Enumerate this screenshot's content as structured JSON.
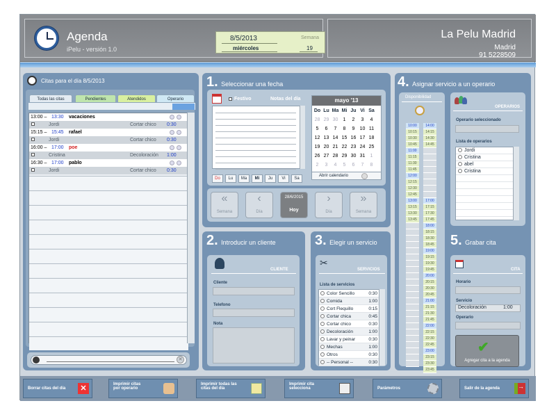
{
  "header": {
    "title": "Agenda",
    "version": "iPelu - versión 1.0",
    "date": "8/5/2013",
    "weekday": "miércoles",
    "week_label": "Semana",
    "week_number": "19",
    "salon_name": "La Pelu Madrid",
    "city": "Madrid",
    "phone": "91 5228509"
  },
  "appointments": {
    "title": "Citas para el día 8/5/2013",
    "tabs": [
      "Todas las citas",
      "Pendientes",
      "Atendidos",
      "Operario"
    ],
    "rows": [
      {
        "time": "13:00 – 13:30",
        "end_color": "#1c3cc8",
        "name": "vacaciones",
        "name_color": "#000000",
        "operator": "Jordi",
        "service": "Cortar chico",
        "duration": "0:30"
      },
      {
        "time": "15:15 – 15:45",
        "end_color": "#1c3cc8",
        "name": "rafael",
        "name_color": "#000000",
        "operator": "Jordi",
        "service": "Cortar chico",
        "duration": "0:30"
      },
      {
        "time": "16:00 – 17:00",
        "end_color": "#1c3cc8",
        "name": "poe",
        "name_color": "#d42020",
        "operator": "Cristina",
        "service": "Decoloración",
        "duration": "1:00"
      },
      {
        "time": "16:30 – 17:00",
        "end_color": "#1c3cc8",
        "name": "pablo",
        "name_color": "#000000",
        "operator": "Jordi",
        "service": "Cortar chico",
        "duration": "0:30"
      }
    ]
  },
  "step1": {
    "number": "1.",
    "title": "Seleccionar una fecha",
    "festivo": "Festivo",
    "notes_title": "Notas del día",
    "month": "mayo '13",
    "weekdays": [
      "Do",
      "Lu",
      "Ma",
      "Mi",
      "Ju",
      "Vi",
      "Sa"
    ],
    "weeks": [
      [
        "28",
        "29",
        "30",
        "1",
        "2",
        "3",
        "4"
      ],
      [
        "5",
        "6",
        "7",
        "8",
        "9",
        "10",
        "11"
      ],
      [
        "12",
        "13",
        "14",
        "15",
        "16",
        "17",
        "18"
      ],
      [
        "19",
        "20",
        "21",
        "22",
        "23",
        "24",
        "25"
      ],
      [
        "26",
        "27",
        "28",
        "29",
        "30",
        "31",
        "1"
      ],
      [
        "2",
        "3",
        "4",
        "5",
        "6",
        "7",
        "8"
      ]
    ],
    "day_buttons": [
      "Do",
      "Lu",
      "Ma",
      "Mi",
      "Ju",
      "Vi",
      "Sa"
    ],
    "open_calendar": "Abrir calendario",
    "nav": {
      "prev_week": "Semana",
      "prev_day": "Día",
      "today_date": "28/6/2015",
      "today": "Hoy",
      "next_day": "Día",
      "next_week": "Semana"
    }
  },
  "step2": {
    "number": "2.",
    "title": "Introducir un cliente",
    "section": "CLIENTE",
    "fields": [
      "Cliente",
      "Telefono",
      "Nota"
    ]
  },
  "step3": {
    "number": "3.",
    "title": "Elegir un servicio",
    "section": "SERVICIOS",
    "list_title": "Lista de servicios",
    "services": [
      {
        "name": "Color Sencillo",
        "time": "0:30"
      },
      {
        "name": "Comida",
        "time": "1:00"
      },
      {
        "name": "Cort Flequillo",
        "time": "0:15"
      },
      {
        "name": "Cortar chica",
        "time": "0:45"
      },
      {
        "name": "Cortar chico",
        "time": "0:30"
      },
      {
        "name": "Decoloración",
        "time": "1:00"
      },
      {
        "name": "Lavar y peinar",
        "time": "0:30"
      },
      {
        "name": "Mechas",
        "time": "1:00"
      },
      {
        "name": "Otros",
        "time": "0:30"
      },
      {
        "name": "-- Personal --",
        "time": "0:30"
      }
    ]
  },
  "step4": {
    "number": "4.",
    "title": "Asignar servicio a un operario",
    "availability": "Disponibilidad",
    "section": "OPERARIOS",
    "selected_label": "Operario seleccionado",
    "list_title": "Lista de operarios",
    "operators": [
      "Jordi",
      "Cristina",
      "abel",
      "Cristina"
    ],
    "times_col1": [
      "10:00",
      "10:15",
      "10:30",
      "10:45",
      "11:00",
      "11:15",
      "11:30",
      "11:45",
      "12:00",
      "12:15",
      "12:30",
      "12:45",
      "13:00",
      "13:15",
      "13:30",
      "13:45"
    ],
    "times_col2": [
      "14:00",
      "14:15",
      "14:30",
      "14:45",
      "",
      "",
      "",
      "",
      "",
      "",
      "",
      "",
      "17:00",
      "17:15",
      "17:30",
      "17:45",
      "18:00",
      "18:15",
      "18:30",
      "18:45",
      "19:00",
      "19:15",
      "19:30",
      "19:45",
      "20:00",
      "20:15",
      "20:30",
      "20:45",
      "21:00",
      "21:15",
      "21:30",
      "21:45",
      "22:00",
      "22:15",
      "22:30",
      "22:45",
      "23:00",
      "23:15",
      "23:30",
      "23:45"
    ]
  },
  "step5": {
    "number": "5.",
    "title": "Grabar cita",
    "section": "CITA",
    "fields": {
      "horario": "Horario",
      "servicio": "Servicio",
      "operario": "Operario"
    },
    "service_value": "Decoloración",
    "service_time": "1:00",
    "add_button": "Agregar cita a la agenda"
  },
  "toolbar": {
    "delete_day": "Borrar citas del día",
    "print_by_operator_1": "Imprimir citas",
    "print_by_operator_2": "por operario",
    "print_all_1": "Imprimir todas las",
    "print_all_2": "citas del  día",
    "print_selected_1": "Imprimir cita",
    "print_selected_2": "selecciona",
    "params": "Parámetros",
    "exit": "Salir de la agenda"
  },
  "colors": {
    "accent": "#7593b3",
    "stripe": "#5e9bd6",
    "today_btn": "#7c7f82",
    "add_green": "#3fa828"
  },
  "icons": [
    "clock-icon",
    "alarm-clock-icon",
    "calendar-icon",
    "search-icon",
    "clear-icon",
    "client-icon",
    "scissors-icon",
    "operators-icon",
    "magnifier-icon",
    "save-icon",
    "checkmark-icon",
    "delete-icon",
    "print-operator-icon",
    "print-all-icon",
    "printer-icon",
    "gears-icon",
    "exit-icon"
  ]
}
